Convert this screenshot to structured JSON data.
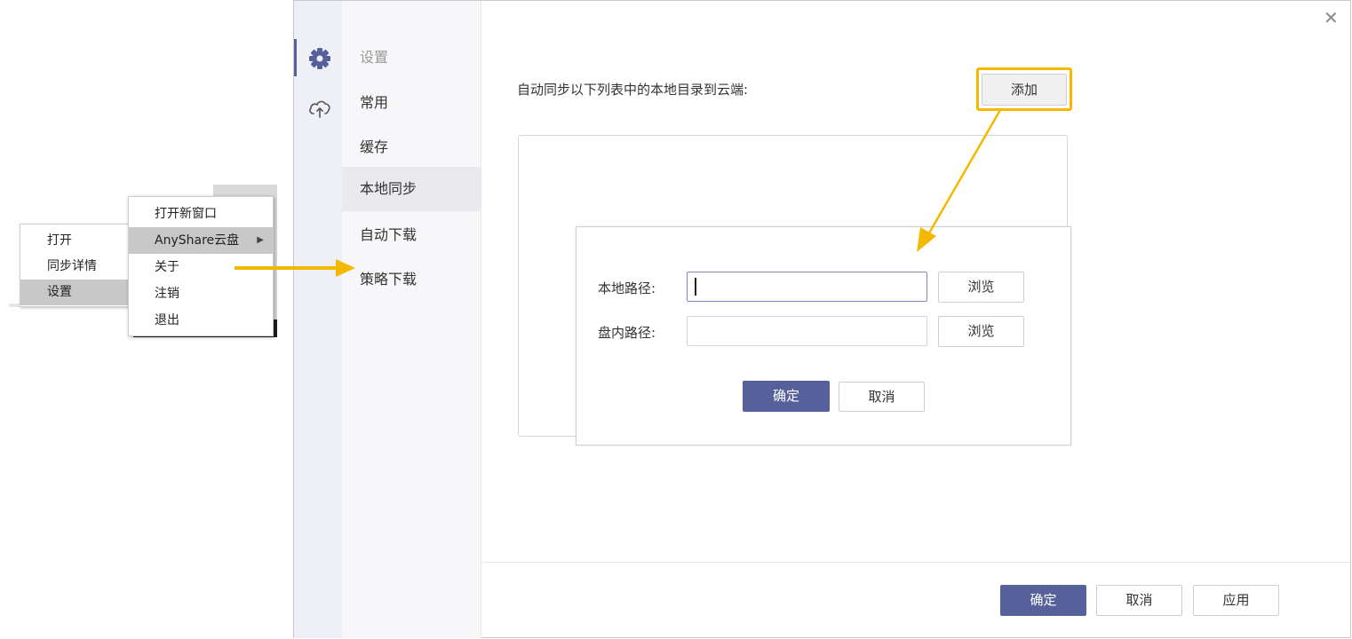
{
  "context_menu": {
    "items": [
      {
        "label": "打开"
      },
      {
        "label": "同步详情"
      },
      {
        "label": "设置"
      }
    ]
  },
  "submenu": {
    "items": [
      {
        "label": "打开新窗口"
      },
      {
        "label": "AnyShare云盘"
      },
      {
        "label": "关于"
      },
      {
        "label": "注销"
      },
      {
        "label": "退出"
      }
    ]
  },
  "nav": {
    "header": "设置",
    "items": [
      {
        "label": "常用"
      },
      {
        "label": "缓存"
      },
      {
        "label": "本地同步"
      },
      {
        "label": "自动下载"
      },
      {
        "label": "策略下载"
      }
    ]
  },
  "main": {
    "description": "自动同步以下列表中的本地目录到云端:",
    "add_label": "添加"
  },
  "sub_dialog": {
    "local_path_label": "本地路径:",
    "cloud_path_label": "盘内路径:",
    "browse_label": "浏览",
    "confirm_label": "确定",
    "cancel_label": "取消"
  },
  "footer": {
    "confirm_label": "确定",
    "cancel_label": "取消",
    "apply_label": "应用"
  },
  "colors": {
    "primary": "#56619c",
    "highlight": "#f5b800"
  },
  "icons": [
    "gear-icon",
    "cloud-upload-icon",
    "close-icon",
    "chevron-right-icon",
    "arrow-right-annotation",
    "arrow-down-annotation"
  ]
}
